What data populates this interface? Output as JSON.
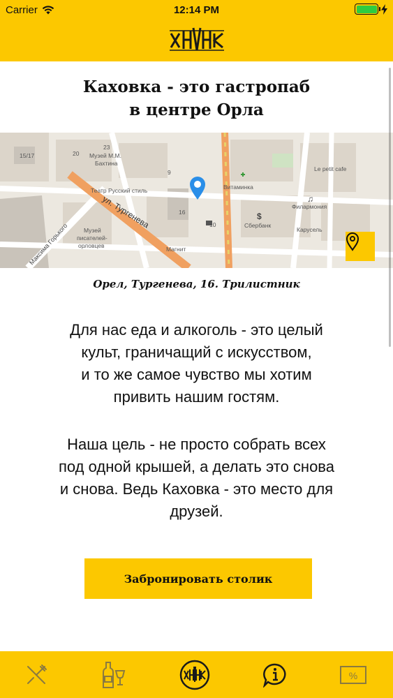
{
  "status_bar": {
    "carrier": "Carrier",
    "time": "12:14 PM"
  },
  "header": {
    "logo_icon": "khvk-logo-icon"
  },
  "content": {
    "title_line1": "Каховка - это гастропаб",
    "title_line2": "в центре Орла",
    "map": {
      "street_label": "ул. Тургенева",
      "street2_label": "Максима Горького",
      "poi_museum": "Музей М.М.",
      "poi_museum2": "Бахтина",
      "poi_theatre": "Театр Русский стиль",
      "poi_vitaminka": "Витаминка",
      "poi_sberbank": "Сбербанк",
      "poi_philharmonic": "Филармония",
      "poi_karusel": "Карусель",
      "poi_magnit": "Магнит",
      "poi_writers1": "Музей",
      "poi_writers2": "писателей-",
      "poi_writers3": "орловцев",
      "poi_lepetit": "Le petit cafe",
      "house_16": "16",
      "house_23": "23",
      "house_20": "20",
      "house_15": "15/17",
      "house_10": "10",
      "house_9": "9"
    },
    "address": "Орел, Тургенева, 16. Трилистник",
    "para1": [
      "Для нас еда и алкоголь - это целый",
      "культ, граничащий с искусством,",
      "и то же самое чувство мы хотим",
      "привить нашим гостям."
    ],
    "para2": [
      "Наша цель - не просто собрать всех",
      "под одной крышей, а делать это снова",
      "и снова. Ведь Каховка - это место для",
      "друзей."
    ],
    "book_button": "Забронировать столик"
  },
  "tabbar": {
    "tabs": [
      {
        "name": "menu-tab",
        "icon": "fork-knife-icon"
      },
      {
        "name": "bar-tab",
        "icon": "bottle-glass-icon"
      },
      {
        "name": "home-tab",
        "icon": "khvk-logo-icon"
      },
      {
        "name": "info-tab",
        "icon": "info-bubble-icon"
      },
      {
        "name": "discounts-tab",
        "icon": "percent-tag-icon"
      }
    ]
  },
  "colors": {
    "accent": "#fcc800",
    "text": "#111111",
    "map_bg": "#ece8e0",
    "road": "#f0a060",
    "pin": "#2a8ee8"
  }
}
